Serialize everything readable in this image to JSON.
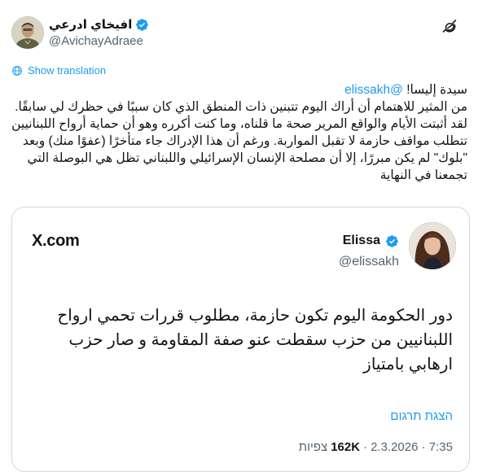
{
  "author": {
    "display_name": "افيخاي ادرعي",
    "handle": "@AvichayAdraee",
    "avatar_icon": "avatar-military-portrait",
    "verified_icon": "verified-badge-icon"
  },
  "toolbar": {
    "grok_icon": "grok-icon"
  },
  "translation_link": "Show translation",
  "tweet": {
    "line1_prefix": "سيدة إليسا! ",
    "line1_mention": "@elissakh",
    "body": "من المثير للاهتمام أن أراك اليوم تتبنين ذات المنطق الذي كان سببًا  في حظرك لي سابقًا. لقد أثبتت الأيام والواقع المرير صحة ما قلناه، وما كنت أكرره وهو أن حماية أرواح اللبنانيين تتطلب مواقف حازمة لا تقبل المواربة. ورغم أن هذا الإدراك جاء متأخرًا (عفوًا منك) وبعد \"بلوك\" لم يكن مبررًا، إلا أن مصلحة الإنسان الإسرائيلي واللبناني تظل هي البوصلة التي تجمعنا في النهاية"
  },
  "quote": {
    "site_label": "X.com",
    "name": "Elissa",
    "handle": "@elissakh",
    "text": "دور الحكومة اليوم تكون حازمة، مطلوب قررات تحمي ارواح اللبنانيين من حزب سقطت عنو صفة المقاومة و صار حزب ارهابي بامتياز",
    "translate_label": "הצגת תרגום",
    "timestamp": "7:35 · 2.3.2026",
    "separator": "·",
    "views_count": "162K",
    "views_label": "צפיות"
  }
}
